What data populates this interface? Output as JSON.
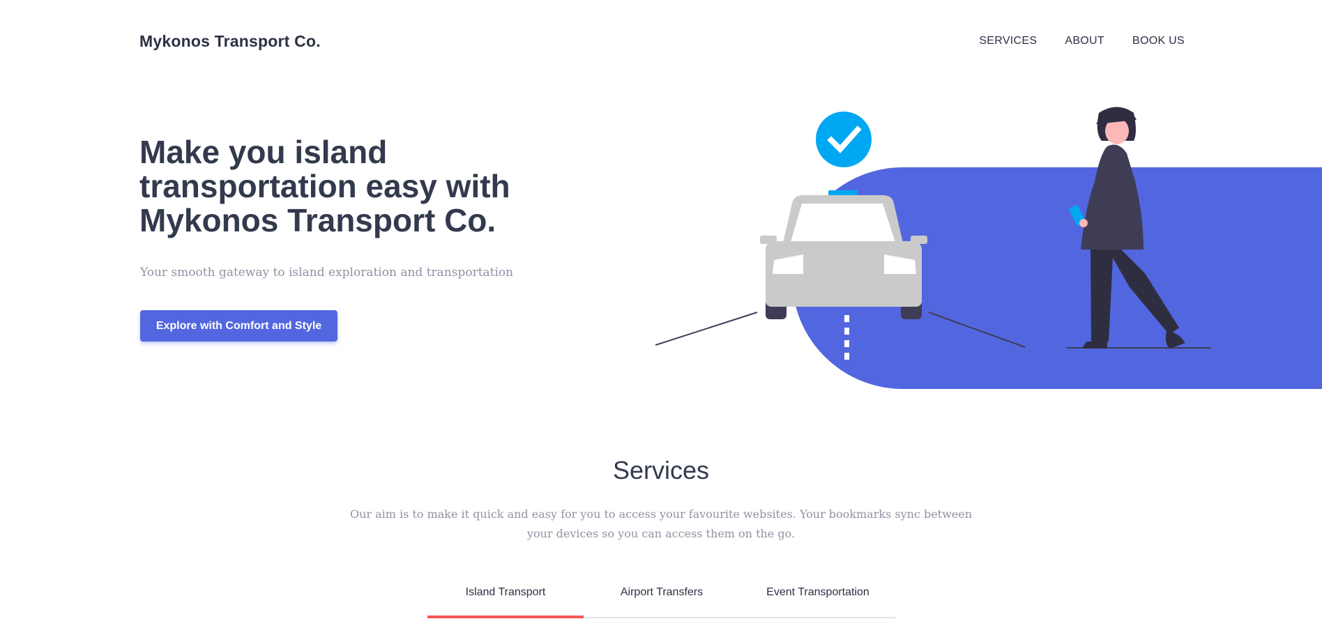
{
  "header": {
    "logo": "Mykonos Transport Co.",
    "nav": [
      "SERVICES",
      "ABOUT",
      "BOOK US"
    ]
  },
  "hero": {
    "title": "Make you island transportation easy with Mykonos Transport Co.",
    "subtitle": "Your smooth gateway to island exploration and transportation",
    "cta": "Explore with Comfort and Style"
  },
  "services": {
    "title": "Services",
    "description": "Our aim is to make it quick and easy for you to access your favourite websites. Your bookmarks sync between your devices so you can access them on the go.",
    "tabs": [
      "Island Transport",
      "Airport Transfers",
      "Event Transportation"
    ],
    "active_tab": "Island Transport"
  },
  "colors": {
    "accent": "#5267df",
    "tab_active": "#fa5757",
    "check": "#00a8f3",
    "text_dark": "#333a4d",
    "text_muted": "#8f93a2"
  }
}
